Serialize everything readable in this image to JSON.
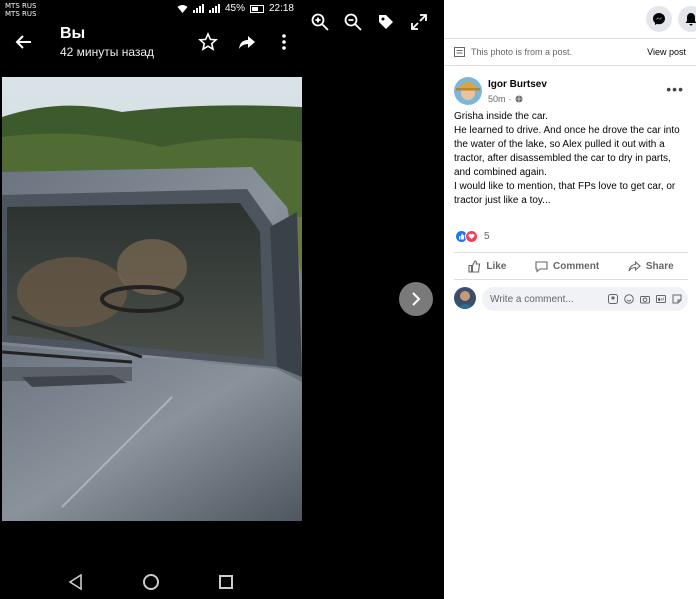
{
  "statusbar": {
    "carrier1": "MTS RUS",
    "carrier2": "MTS RUS",
    "battery": "45%",
    "time": "22:18"
  },
  "viewer": {
    "title": "Вы",
    "subtitle": "42 минуты назад",
    "icons": [
      "back-icon",
      "star-icon",
      "share-icon",
      "more-vert-icon",
      "zoom-in-icon",
      "zoom-out-icon",
      "tag-icon",
      "fullscreen-icon",
      "chevron-right-icon"
    ]
  },
  "post": {
    "source_note": "This photo is from a post.",
    "view_post": "View post",
    "author": "Igor Burtsev",
    "time": "50m",
    "audience": "·",
    "lines": [
      "Grisha inside the car.",
      "He learned to drive. And once he drove the car into the water of the lake, so Alex pulled it out with a tractor, after disassembled the car to dry in parts, and combined again.",
      "I would like to mention, that FPs love to get car, or tractor just like a toy..."
    ],
    "reaction_count": "5",
    "actions": {
      "like": "Like",
      "comment": "Comment",
      "share": "Share"
    },
    "comment_placeholder": "Write a comment..."
  },
  "colors": {
    "facebook_blue": "#1877f2",
    "love_red": "#f33e58",
    "panel_bg": "#ffffff",
    "viewer_bg": "#000000"
  }
}
